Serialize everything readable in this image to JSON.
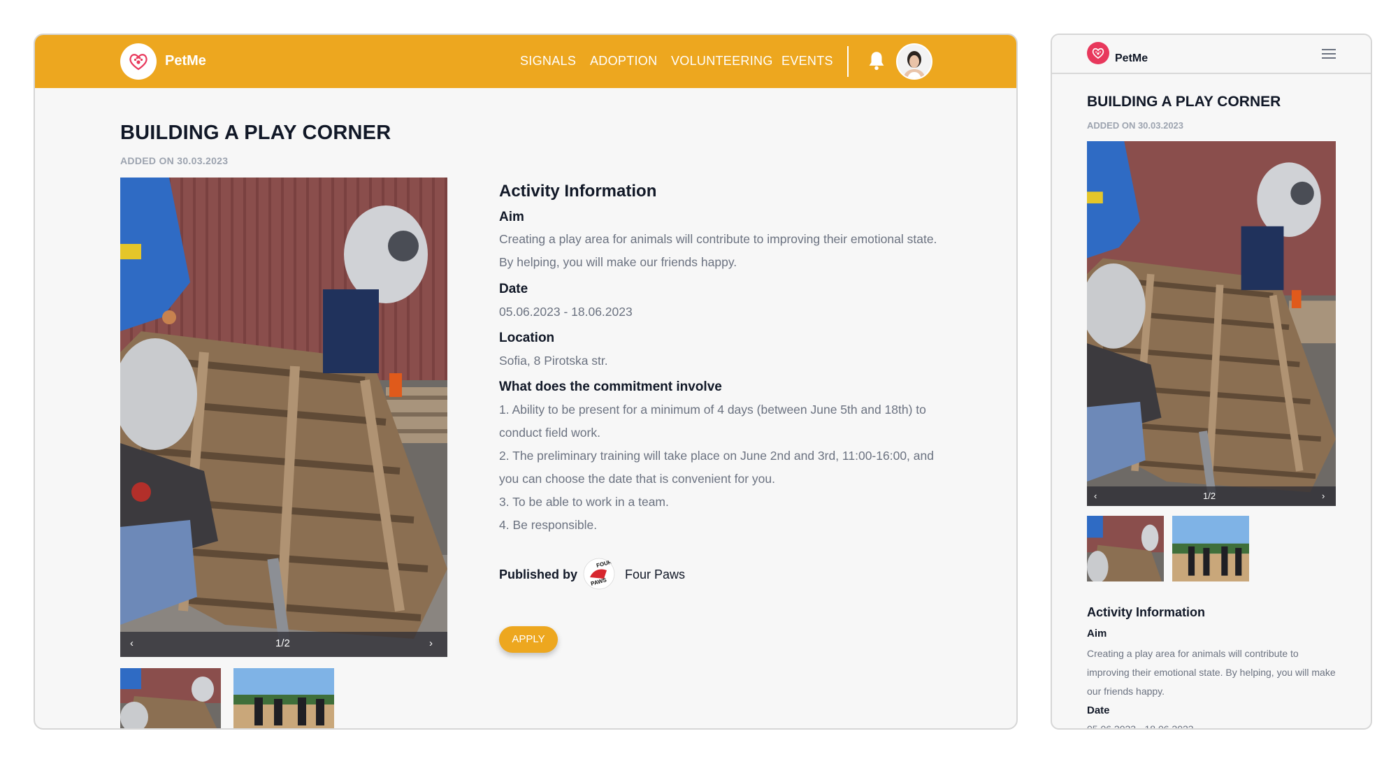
{
  "app": {
    "name": "PetMe"
  },
  "nav": {
    "items": [
      "SIGNALS",
      "ADOPTION",
      "VOLUNTEERING",
      "EVENTS"
    ]
  },
  "page": {
    "title": "BUILDING A PLAY CORNER",
    "added": "ADDED ON 30.03.2023"
  },
  "gallery": {
    "counter": "1/2",
    "prev_glyph": "‹",
    "next_glyph": "›"
  },
  "info": {
    "heading": "Activity Information",
    "aim_label": "Aim",
    "aim_text": "Creating a play area for animals will contribute to improving their emotional state. By helping, you will make our friends happy.",
    "date_label": "Date",
    "date_text": "05.06.2023 - 18.06.2023",
    "location_label": "Location",
    "location_text": "Sofia, 8 Pirotska str.",
    "commitment_label": "What does the commitment involve",
    "commitment_items": [
      "1. Ability to be present for a minimum of 4 days (between June 5th and 18th) to conduct field work.",
      "2. The preliminary training will take place on June 2nd and 3rd, 11:00-16:00, and you can choose the date that is convenient for you.",
      "3. To be able to work in a team.",
      "4. Be responsible."
    ]
  },
  "publisher": {
    "label": "Published by",
    "name": "Four Paws",
    "logo_text": "FOUR PAWS"
  },
  "actions": {
    "apply": "APPLY"
  },
  "colors": {
    "accent": "#eda71f",
    "logo_red": "#e8385c",
    "text": "#111827",
    "muted": "#6b7280"
  },
  "icons": [
    "paw-heart-logo-icon",
    "bell-icon",
    "chevron-left-icon",
    "chevron-right-icon",
    "hamburger-menu-icon"
  ]
}
